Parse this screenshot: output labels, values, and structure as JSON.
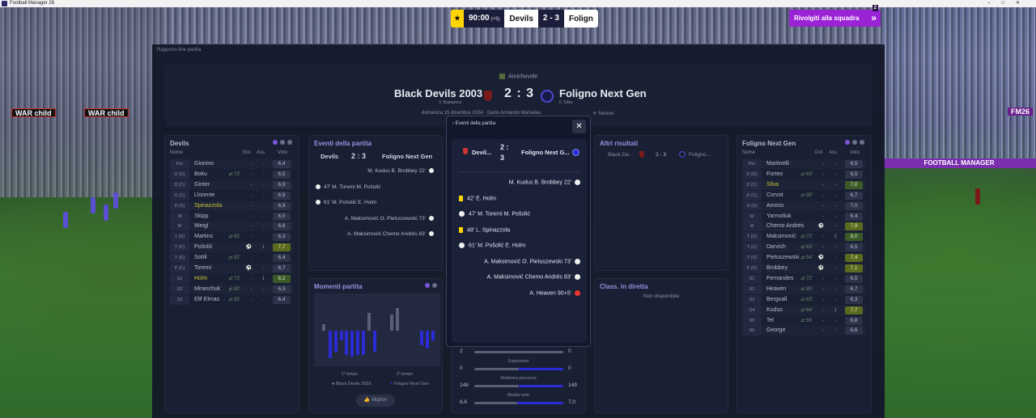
{
  "window": {
    "title": "Football Manager 26"
  },
  "scoreboard": {
    "time": "90:00",
    "added": "(+5)",
    "home": "Devils",
    "score": "2 - 3",
    "away": "Folign"
  },
  "return_button": {
    "label": "Rivolgiti alla squadra",
    "count": "2"
  },
  "breadcrumb": "Rapporto fine partita",
  "header": {
    "competition": "Amichevole",
    "home": "Black Devils 2003",
    "away": "Foligno Next Gen",
    "score": "2 : 3",
    "home_coach": "V. Buenpons",
    "away_coach": "F. Silva",
    "date": "domenica 15 dicembre 2024",
    "venue": "Dario Armando Marseleu",
    "weather": "Sereno"
  },
  "home_lineup": {
    "title": "Devils",
    "cols": {
      "name": "Nome",
      "goals": "Gol",
      "assists": "Ass",
      "rating": "Voto"
    },
    "rows": [
      {
        "pos": "Por",
        "name": "Gionino",
        "sub": "",
        "g": "-",
        "a": "-",
        "r": "6,4",
        "cls": ""
      },
      {
        "pos": "D (D)",
        "name": "Boku",
        "sub": "⇄ 72'",
        "g": "-",
        "a": "-",
        "r": "6,5",
        "cls": ""
      },
      {
        "pos": "D (C)",
        "name": "Ginter",
        "sub": "",
        "g": "-",
        "a": "-",
        "r": "6,9",
        "cls": ""
      },
      {
        "pos": "D (C)",
        "name": "Llorente",
        "sub": "",
        "g": "-",
        "a": "-",
        "r": "6,9",
        "cls": ""
      },
      {
        "pos": "D (S)",
        "name": "Spinazzola",
        "sub": "",
        "g": "-",
        "a": "-",
        "r": "6,9",
        "cls": ""
      },
      {
        "pos": "M",
        "name": "Skipp",
        "sub": "",
        "g": "-",
        "a": "-",
        "r": "6,5",
        "cls": ""
      },
      {
        "pos": "M",
        "name": "Weigl",
        "sub": "",
        "g": "-",
        "a": "-",
        "r": "6,6",
        "cls": ""
      },
      {
        "pos": "T (D)",
        "name": "Martins",
        "sub": "⇄ 82'",
        "g": "-",
        "a": "-",
        "r": "6,3",
        "cls": ""
      },
      {
        "pos": "T (C)",
        "name": "Pošolić",
        "sub": "",
        "g": "⚽",
        "a": "1",
        "r": "7,7",
        "cls": "vg"
      },
      {
        "pos": "T (S)",
        "name": "Sottil",
        "sub": "⇄ 82'",
        "g": "-",
        "a": "-",
        "r": "6,4",
        "cls": ""
      },
      {
        "pos": "P (C)",
        "name": "Toremi",
        "sub": "",
        "g": "⚽",
        "a": "-",
        "r": "6,7",
        "cls": ""
      },
      {
        "pos": "S1",
        "name": "Holm",
        "sub": "⇄ 72'",
        "g": "-",
        "a": "1",
        "r": "6,2",
        "cls": "good"
      },
      {
        "pos": "S2",
        "name": "Miranchuk",
        "sub": "⇄ 82'",
        "g": "-",
        "a": "-",
        "r": "6,5",
        "cls": ""
      },
      {
        "pos": "S3",
        "name": "Elif Elmas",
        "sub": "⇄ 82'",
        "g": "-",
        "a": "-",
        "r": "6,4",
        "cls": ""
      }
    ]
  },
  "away_lineup": {
    "title": "Foligno Next Gen",
    "cols": {
      "name": "Nome",
      "goals": "Gol",
      "assists": "Ass",
      "rating": "Voto"
    },
    "rows": [
      {
        "pos": "Por",
        "name": "Martinelli",
        "sub": "",
        "g": "-",
        "a": "-",
        "r": "6,5",
        "cls": ""
      },
      {
        "pos": "D (D)",
        "name": "Forteo",
        "sub": "⇄ 63'",
        "g": "-",
        "a": "-",
        "r": "6,5",
        "cls": ""
      },
      {
        "pos": "D (C)",
        "name": "Silva",
        "sub": "",
        "g": "-",
        "a": "-",
        "r": "7,0",
        "cls": "good"
      },
      {
        "pos": "D (C)",
        "name": "Corvot",
        "sub": "⇄ 90'",
        "g": "-",
        "a": "-",
        "r": "6,7",
        "cls": ""
      },
      {
        "pos": "D (S)",
        "name": "Amoss",
        "sub": "",
        "g": "-",
        "a": "-",
        "r": "7,0",
        "cls": ""
      },
      {
        "pos": "M",
        "name": "Yarmoliuk",
        "sub": "",
        "g": "-",
        "a": "-",
        "r": "6,4",
        "cls": ""
      },
      {
        "pos": "M",
        "name": "Chemo Andrés",
        "sub": "",
        "g": "⚽",
        "a": "-",
        "r": "7,9",
        "cls": "vg"
      },
      {
        "pos": "T (D)",
        "name": "Maksimović",
        "sub": "⇄ 72'",
        "g": "-",
        "a": "2",
        "r": "8,0",
        "cls": "good"
      },
      {
        "pos": "T (C)",
        "name": "Darvich",
        "sub": "⇄ 63'",
        "g": "-",
        "a": "-",
        "r": "6,5",
        "cls": ""
      },
      {
        "pos": "T (S)",
        "name": "Pietuszewski",
        "sub": "⇄ 54'",
        "g": "⚽",
        "a": "-",
        "r": "7,4",
        "cls": "vg"
      },
      {
        "pos": "P (C)",
        "name": "Brobbey",
        "sub": "",
        "g": "⚽",
        "a": "-",
        "r": "7,1",
        "cls": "vg"
      },
      {
        "pos": "S1",
        "name": "Fernandes",
        "sub": "⇄ 72'",
        "g": "-",
        "a": "-",
        "r": "6,5",
        "cls": ""
      },
      {
        "pos": "S2",
        "name": "Heaven",
        "sub": "⇄ 90'",
        "g": "-",
        "a": "-",
        "r": "6,7",
        "cls": ""
      },
      {
        "pos": "S3",
        "name": "Bergvall",
        "sub": "⇄ 63'",
        "g": "-",
        "a": "-",
        "r": "6,3",
        "cls": ""
      },
      {
        "pos": "S4",
        "name": "Kudus",
        "sub": "⇄ 64'",
        "g": "-",
        "a": "1",
        "r": "7,7",
        "cls": "vg"
      },
      {
        "pos": "S5",
        "name": "Tel",
        "sub": "⇄ 55'",
        "g": "-",
        "a": "-",
        "r": "6,8",
        "cls": ""
      },
      {
        "pos": "S6",
        "name": "George",
        "sub": "",
        "g": "-",
        "a": "-",
        "r": "6,6",
        "cls": ""
      }
    ]
  },
  "events_panel": {
    "title": "Eventi della partita",
    "home": "Devils",
    "score": "2 : 3",
    "away": "Foligno Next Gen",
    "rows": [
      {
        "text": "M. Kudus B. Brobbey 22'",
        "side": "away"
      },
      {
        "text": "47' M. Toremi M. Pošolić",
        "side": "home"
      },
      {
        "text": "61' M. Pošolić E. Holm",
        "side": "home"
      },
      {
        "text": "A. Maksimović O. Pietuszewski 73'",
        "side": "away"
      },
      {
        "text": "A. Maksimović Chemo Andrés 83'",
        "side": "away"
      }
    ]
  },
  "moments": {
    "title": "Momenti partita",
    "half1": "1° tempo",
    "half2": "2° tempo",
    "legend_home": "Black Devils 2003",
    "legend_away": "Foligno Next Gen",
    "button": "Migliori"
  },
  "other_results": {
    "title": "Altri risultati",
    "home": "Black De...",
    "score": "2 - 3",
    "away": "Foligno..."
  },
  "live_table": {
    "title": "Class. in diretta",
    "empty": "Non disponibile"
  },
  "stats": [
    {
      "label": "",
      "home": "2",
      "away": "0",
      "hp": 1.0
    },
    {
      "label": "Espulsioni",
      "home": "0",
      "away": "0",
      "hp": 0.5
    },
    {
      "label": "Distanza percorsa",
      "home": "148",
      "away": "149",
      "hp": 0.5
    },
    {
      "label": "Media voto",
      "home": "6,6",
      "away": "7,0",
      "hp": 0.48
    }
  ],
  "modal": {
    "title": "Eventi della partita",
    "close": "✕",
    "home": "Devil...",
    "score_top": "2 :",
    "score_bot": "3",
    "away": "Foligno Next G...",
    "rows": [
      {
        "icon": "ball",
        "text": "M. Kudus B. Brobbey 22'",
        "side": "away"
      },
      {
        "icon": "yellow",
        "text": "42' E. Holm",
        "side": "home"
      },
      {
        "icon": "ball",
        "text": "47' M. Toremi M. Pošolić",
        "side": "home"
      },
      {
        "icon": "yellow",
        "text": "48' L. Spinazzola",
        "side": "home"
      },
      {
        "icon": "ball",
        "text": "61' M. Pošolić E. Holm",
        "side": "home"
      },
      {
        "icon": "ball",
        "text": "A. Maksimović O. Pietuszewski 73'",
        "side": "away"
      },
      {
        "icon": "ball",
        "text": "A. Maksimović Chemo Andrés 83'",
        "side": "away"
      },
      {
        "icon": "injury",
        "text": "A. Heaven 90+5'",
        "side": "away"
      }
    ]
  },
  "ads": {
    "war": "WAR child",
    "fm26": "FM26",
    "football_manager": "FOOTBALL MANAGER"
  }
}
